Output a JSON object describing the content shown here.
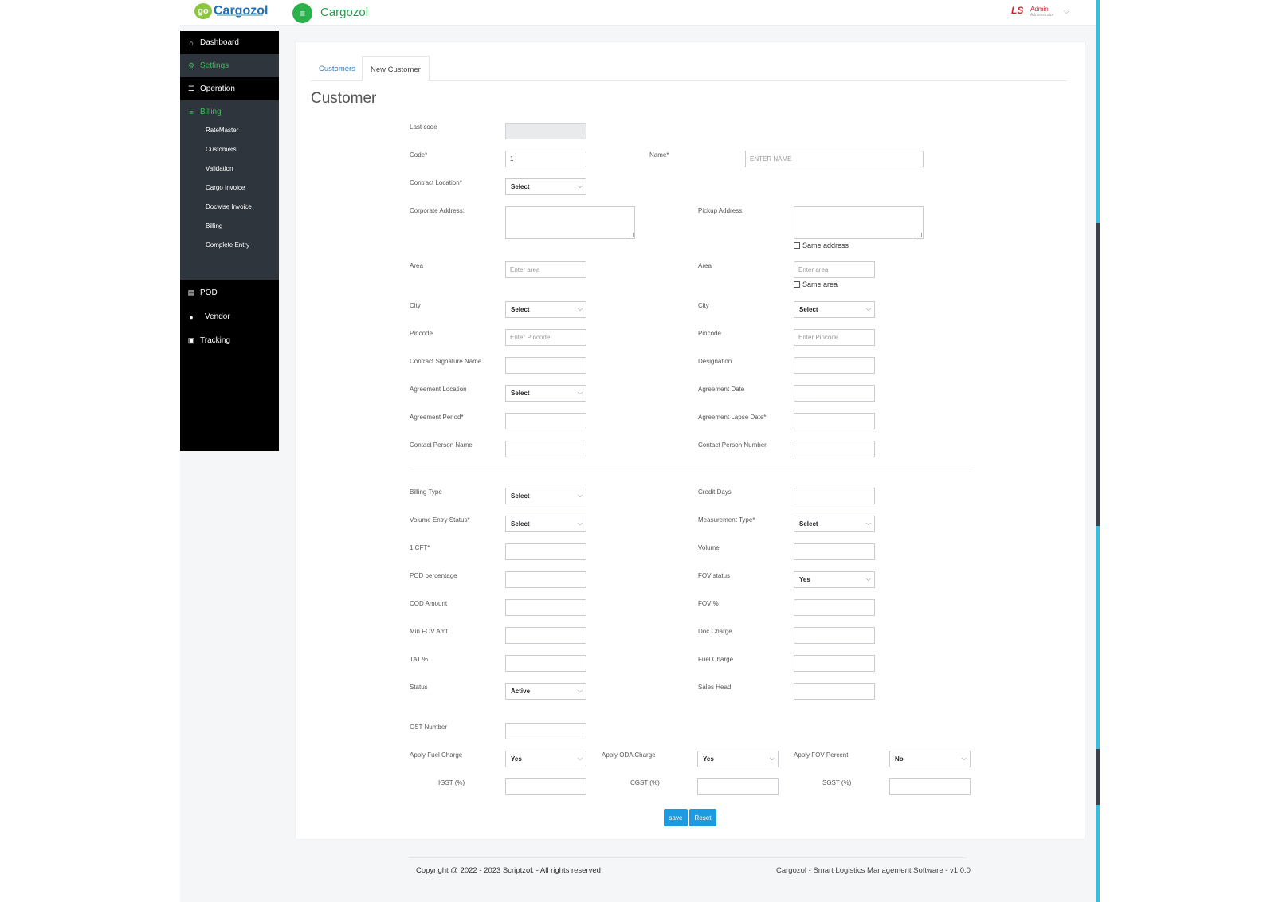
{
  "header": {
    "logo_mark": "go",
    "logo_text": "Cargozol",
    "menu_icon": "≡",
    "brand": "Cargozol",
    "user_name": "Admin",
    "user_role": "Administrator"
  },
  "sidebar": {
    "items": [
      {
        "label": "Dashboard",
        "icon": "home-icon"
      },
      {
        "label": "Settings",
        "icon": "gear-icon"
      },
      {
        "label": "Operation",
        "icon": "list-icon"
      },
      {
        "label": "Billing",
        "icon": "menu-icon"
      },
      {
        "label": "POD",
        "icon": "database-icon"
      },
      {
        "label": "Vendor",
        "icon": "user-icon"
      },
      {
        "label": "Tracking",
        "icon": "tracking-icon"
      }
    ],
    "sub_items": [
      "RateMaster",
      "Customers",
      "Validation",
      "Cargo Invoice",
      "Docwise Invoice",
      "Billing",
      "Complete Entry"
    ]
  },
  "tabs": {
    "customers": "Customers",
    "new_customer": "New Customer"
  },
  "page_title": "Customer",
  "form": {
    "last_code": "Last code",
    "code": "Code*",
    "code_value": "1",
    "name": "Name*",
    "name_placeholder": "ENTER NAME",
    "contract_location": "Contract Location*",
    "select": "Select",
    "corporate_address": "Corporate Address:",
    "pickup_address": "Pickup Address:",
    "same_address": "Same address",
    "area": "Area",
    "area_placeholder": "Enter area",
    "same_area": "Same area",
    "city": "City",
    "pincode": "Pincode",
    "pincode_placeholder": "Enter Pincode",
    "contract_signature_name": "Contract Signature Name",
    "designation": "Designation",
    "agreement_location": "Agreement Location",
    "agreement_date": "Agreement Date",
    "agreement_period": "Agreement Period*",
    "agreement_lapse_date": "Agreement Lapse Date*",
    "contact_person_name": "Contact Person Name",
    "contact_person_number": "Contact Person Number",
    "billing_type": "Billing Type",
    "credit_days": "Credit Days",
    "volume_entry_status": "Volume Entry Status*",
    "measurement_type": "Measurement Type*",
    "one_cft": "1 CFT*",
    "volume": "Volume",
    "pod_percentage": "POD percentage",
    "fov_status": "FOV status",
    "fov_status_value": "Yes",
    "cod_amount": "COD Amount",
    "fov_percent": "FOV %",
    "min_fov_amt": "Min FOV Amt",
    "doc_charge": "Doc Charge",
    "tat_percent": "TAT %",
    "fuel_charge": "Fuel Charge",
    "status": "Status",
    "status_value": "Active",
    "sales_head": "Sales Head",
    "gst_number": "GST Number",
    "apply_fuel_charge": "Apply Fuel Charge",
    "apply_fuel_charge_value": "Yes",
    "apply_oda_charge": "Apply ODA Charge",
    "apply_oda_charge_value": "Yes",
    "apply_fov_percent": "Apply FOV Percent",
    "apply_fov_percent_value": "No",
    "igst": "IGST (%)",
    "cgst": "CGST (%)",
    "sgst": "SGST (%)",
    "save": "save",
    "reset": "Reset"
  },
  "footer": {
    "copyright": "Copyright @ 2022 - 2023 Scriptzol. - All rights reserved",
    "version": "Cargozol - Smart Logistics Management Software - v1.0.0"
  },
  "colors": {
    "accent_green": "#3db75a",
    "link_blue": "#3a7bbd",
    "button_blue": "#1e9be0",
    "sidebar_dark": "#000000"
  }
}
